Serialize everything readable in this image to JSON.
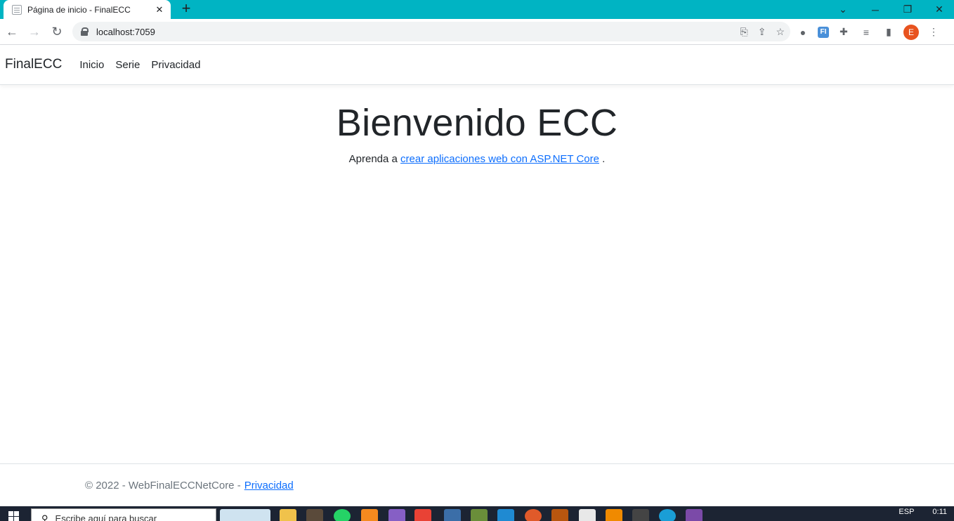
{
  "browser": {
    "tab_title": "Página de inicio - FinalECC",
    "new_tab": "+",
    "url": "localhost:7059",
    "profile_initial": "E",
    "ext_fi_label": "FI"
  },
  "navbar": {
    "brand": "FinalECC",
    "links": [
      "Inicio",
      "Serie",
      "Privacidad"
    ]
  },
  "main": {
    "heading": "Bienvenido ECC",
    "lead_prefix": "Aprenda a ",
    "lead_link": "crear aplicaciones web con ASP.NET Core",
    "lead_suffix": " ."
  },
  "footer": {
    "text": "© 2022 - WebFinalECCNetCore - ",
    "link": "Privacidad"
  },
  "taskbar": {
    "search_placeholder": "Escribe aquí para buscar",
    "language": "ESP",
    "time": "0:11"
  },
  "colors": {
    "tabstrip": "#00b4c3",
    "link": "#0d6efd",
    "avatar": "#e8531f"
  }
}
